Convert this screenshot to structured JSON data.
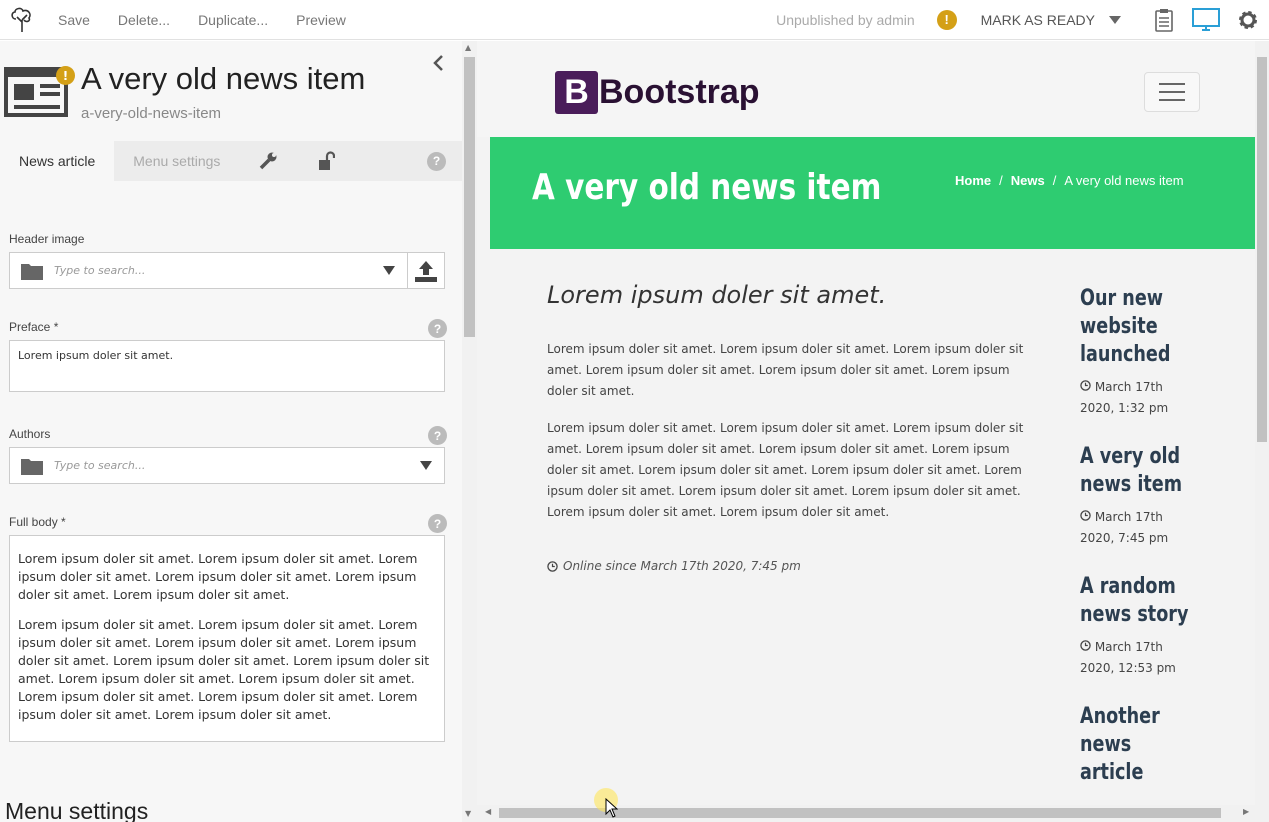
{
  "toolbar": {
    "save": "Save",
    "delete": "Delete...",
    "duplicate": "Duplicate...",
    "preview": "Preview",
    "status": "Unpublished by admin",
    "mark_ready": "MARK AS READY",
    "icons": [
      "tree-logo-icon",
      "warning-icon",
      "clipboard-icon",
      "desktop-icon",
      "gear-icon"
    ]
  },
  "editor": {
    "title": "A very old news item",
    "slug": "a-very-old-news-item",
    "tabs": [
      "News article",
      "Menu settings"
    ],
    "fields": {
      "header_image": {
        "label": "Header image",
        "placeholder": "Type to search..."
      },
      "preface": {
        "label": "Preface *",
        "value": "Lorem ipsum doler sit amet."
      },
      "authors": {
        "label": "Authors",
        "placeholder": "Type to search..."
      },
      "full_body": {
        "label": "Full body *",
        "p1": "Lorem ipsum doler sit amet. Lorem ipsum doler sit amet. Lorem ipsum doler sit amet. Lorem ipsum doler sit amet. Lorem ipsum doler sit amet. Lorem ipsum doler sit amet.",
        "p2": "Lorem ipsum doler sit amet. Lorem ipsum doler sit amet. Lorem ipsum doler sit amet. Lorem ipsum doler sit amet. Lorem ipsum doler sit amet. Lorem ipsum doler sit amet. Lorem ipsum doler sit amet. Lorem ipsum doler sit amet. Lorem ipsum doler sit amet. Lorem ipsum doler sit amet. Lorem ipsum doler sit amet. Lorem ipsum doler sit amet. Lorem ipsum doler sit amet."
      }
    },
    "section_heading": "Menu settings"
  },
  "preview": {
    "brand_letter": "B",
    "brand_name": "Bootstrap",
    "hero_title": "A very old news item",
    "breadcrumb": [
      "Home",
      "News",
      "A very old news item"
    ],
    "breadcrumb_sep": "/",
    "lead": "Lorem ipsum doler sit amet.",
    "p1": "Lorem ipsum doler sit amet. Lorem ipsum doler sit amet. Lorem ipsum doler sit amet. Lorem ipsum doler sit amet. Lorem ipsum doler sit amet. Lorem ipsum doler sit amet.",
    "p2": "Lorem ipsum doler sit amet. Lorem ipsum doler sit amet. Lorem ipsum doler sit amet. Lorem ipsum doler sit amet. Lorem ipsum doler sit amet. Lorem ipsum doler sit amet. Lorem ipsum doler sit amet. Lorem ipsum doler sit amet. Lorem ipsum doler sit amet. Lorem ipsum doler sit amet. Lorem ipsum doler sit amet. Lorem ipsum doler sit amet. Lorem ipsum doler sit amet.",
    "online": "Online since March 17th 2020, 7:45 pm",
    "sidebar": [
      {
        "title": "Our new website launched",
        "date": "March 17th 2020, 1:32 pm"
      },
      {
        "title": "A very old news item",
        "date": "March 17th 2020, 7:45 pm"
      },
      {
        "title": "A random news story",
        "date": "March 17th 2020, 12:53 pm"
      },
      {
        "title": "Another news article",
        "date": ""
      }
    ]
  },
  "colors": {
    "hero": "#2ecc71",
    "warning": "#d4a017",
    "sidebar_title": "#2c3e50",
    "brand": "#4a1d5a"
  }
}
